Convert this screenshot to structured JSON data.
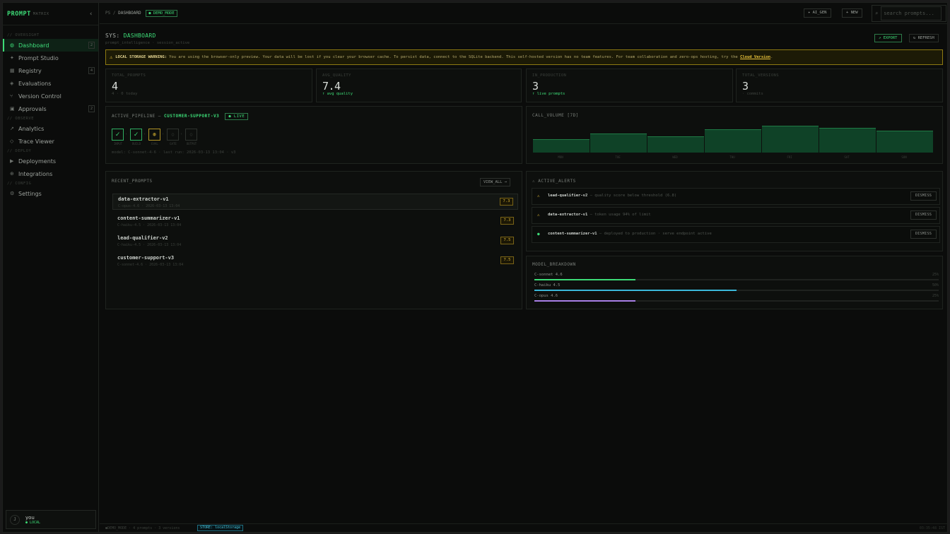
{
  "brand": {
    "name": "PROMPT",
    "suffix": "MATRIX",
    "collapse": "‹"
  },
  "sidebar": {
    "sections": [
      {
        "label": "// OVERSIGHT",
        "items": [
          {
            "label": "Dashboard",
            "icon": "◍",
            "count": "2"
          },
          {
            "label": "Prompt Studio",
            "icon": "✦",
            "count": ""
          },
          {
            "label": "Registry",
            "icon": "▦",
            "count": "4"
          },
          {
            "label": "Evaluations",
            "icon": "◈",
            "count": ""
          },
          {
            "label": "Version Control",
            "icon": "⑂",
            "count": ""
          },
          {
            "label": "Approvals",
            "icon": "▣",
            "count": "2"
          }
        ]
      },
      {
        "label": "// OBSERVE",
        "items": [
          {
            "label": "Analytics",
            "icon": "↗",
            "count": ""
          },
          {
            "label": "Trace Viewer",
            "icon": "◇",
            "count": ""
          }
        ]
      },
      {
        "label": "// DEPLOY",
        "items": [
          {
            "label": "Deployments",
            "icon": "▶",
            "count": ""
          },
          {
            "label": "Integrations",
            "icon": "⊕",
            "count": ""
          }
        ]
      },
      {
        "label": "// CONFIG",
        "items": [
          {
            "label": "Settings",
            "icon": "⚙",
            "count": ""
          }
        ]
      }
    ],
    "user": {
      "initial": "J",
      "name": "you",
      "status": "● LOCAL"
    }
  },
  "topbar": {
    "crumb_root": "PS",
    "crumb_sep": "/",
    "crumb_current": "DASHBOARD",
    "demo_badge": "● DEMO_MODE",
    "ai_gen_label": "✦ AI_GEN",
    "new_label": "+ NEW",
    "search_icon": "⌕",
    "search_placeholder": "search prompts..."
  },
  "page": {
    "title_prefix": "SYS:",
    "title": "DASHBOARD",
    "subtitle": "prompt_intelligence · session_active",
    "export_label": "↗ EXPORT",
    "refresh_label": "↻ REFRESH"
  },
  "warning": {
    "icon": "⚠",
    "title": "LOCAL STORAGE WARNING:",
    "text": "You are using the browser-only preview. Your data will be lost if you clear your browser cache. To persist data, connect to the SQLite backend. This self-hosted version has no team features. For team collaboration and zero-ops hosting, try the",
    "link": "Cloud Version",
    "end": "."
  },
  "stats": [
    {
      "label": "TOTAL_PROMPTS",
      "value": "4",
      "sub": "4 · 0 today",
      "accent": false
    },
    {
      "label": "AVG_QUALITY",
      "value": "7.4",
      "sub": "↑ avg quality",
      "accent": true
    },
    {
      "label": "IN_PRODUCTION",
      "value": "3",
      "sub": "↑ live prompts",
      "accent": true
    },
    {
      "label": "TOTAL_VERSIONS",
      "value": "3",
      "sub": "· commits",
      "accent": false
    }
  ],
  "pipeline": {
    "title": "ACTIVE_PIPELINE —",
    "name": "CUSTOMER-SUPPORT-V3",
    "live": "● LIVE",
    "stages": [
      {
        "label": "INPUT",
        "state": "done",
        "glyph": "✓"
      },
      {
        "label": "BUILD",
        "state": "done",
        "glyph": "✓"
      },
      {
        "label": "EVAL",
        "state": "run",
        "glyph": "◍"
      },
      {
        "label": "GATE",
        "state": "pend",
        "glyph": "○"
      },
      {
        "label": "OUTPUT",
        "state": "pend",
        "glyph": "○"
      }
    ],
    "meta": "model: C-sonnet-4-6 · last run: 2026-03-13 13:04 · v3"
  },
  "call_volume": {
    "title": "CALL_VOLUME [7D]"
  },
  "chart_data": {
    "type": "bar",
    "title": "CALL_VOLUME [7D]",
    "categories": [
      "MON",
      "TUE",
      "WED",
      "THU",
      "FRI",
      "SAT",
      "SUN"
    ],
    "values": [
      48,
      68,
      58,
      82,
      96,
      88,
      78
    ],
    "ylim": [
      0,
      100
    ]
  },
  "recent": {
    "title": "RECENT_PROMPTS",
    "view_all": "VIEW_ALL →",
    "rows": [
      {
        "name": "data-extractor-v1",
        "meta": "C-opus-4.6 · 2026-03-13 13:04",
        "score": "7.3"
      },
      {
        "name": "content-summarizer-v1",
        "meta": "C-haiku-4.5 · 2026-03-13 13:04",
        "score": "7.3"
      },
      {
        "name": "lead-qualifier-v2",
        "meta": "C-haiku-4.5 · 2026-03-13 13:04",
        "score": "7.5"
      },
      {
        "name": "customer-support-v3",
        "meta": "C-sonnet-4.6 · 2026-03-13 13:04",
        "score": "7.5"
      }
    ]
  },
  "alerts": {
    "title_icon": "⚠",
    "title": "ACTIVE_ALERTS",
    "items": [
      {
        "icon": "⚠",
        "color": "#e9c23a",
        "name": "lead-qualifier-v2",
        "text": " — quality score below threshold (6.8)",
        "action": "DISMISS"
      },
      {
        "icon": "⚠",
        "color": "#e9c23a",
        "name": "data-extractor-v1",
        "text": " — token usage 94% of limit",
        "action": "DISMISS"
      },
      {
        "icon": "●",
        "color": "#3ddc77",
        "name": "content-summarizer-v1",
        "text": " — deployed to production · serve endpoint active",
        "action": "DISMISS"
      }
    ]
  },
  "models": {
    "title": "MODEL_BREAKDOWN",
    "items": [
      {
        "name": "C-sonnet 4.6",
        "pct": 25,
        "pct_label": "25%",
        "color": "#3ddc77"
      },
      {
        "name": "C-haiku 4.5",
        "pct": 50,
        "pct_label": "50%",
        "color": "#3bb8d9"
      },
      {
        "name": "C-opus 4.6",
        "pct": 25,
        "pct_label": "25%",
        "color": "#a87fe6"
      }
    ]
  },
  "statusbar": {
    "left": "●DEMO_MODE · 4 prompts · 3 versions",
    "store": "STORE: localStorage",
    "clock": "03:35:48 IST"
  }
}
